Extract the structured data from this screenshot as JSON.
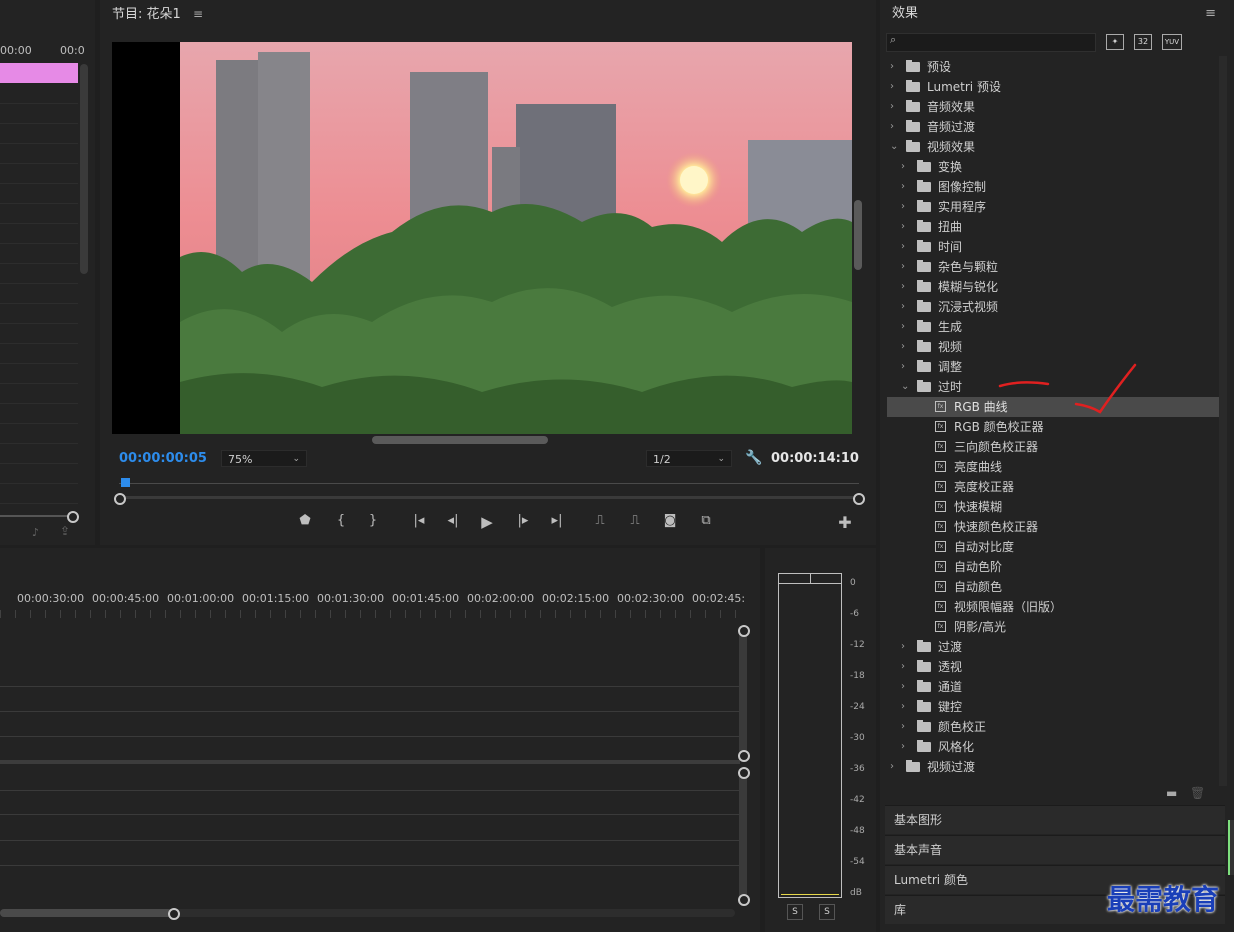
{
  "source_panel": {
    "ruler_left": "00:00",
    "ruler_right": "00:0"
  },
  "program": {
    "title": "节目: 花朵1",
    "current_tc": "00:00:00:05",
    "zoom": "75%",
    "resolution": "1/2",
    "duration_tc": "00:00:14:10",
    "playhead_fraction": 0.006
  },
  "timeline": {
    "ruler_labels": [
      "00:00:30:00",
      "00:00:45:00",
      "00:01:00:00",
      "00:01:15:00",
      "00:01:30:00",
      "00:01:45:00",
      "00:02:00:00",
      "00:02:15:00",
      "00:02:30:00",
      "00:02:45:"
    ]
  },
  "meter": {
    "scale": [
      "0",
      "-6",
      "-12",
      "-18",
      "-24",
      "-30",
      "-36",
      "-42",
      "-48",
      "-54",
      "dB"
    ],
    "solo_left": "S",
    "solo_right": "S"
  },
  "effects": {
    "title": "效果",
    "search_placeholder": "",
    "badge1": "32",
    "badge2": "YUV",
    "tree": [
      {
        "label": "预设",
        "level": 0,
        "kind": "preset",
        "expanded": false
      },
      {
        "label": "Lumetri 预设",
        "level": 0,
        "kind": "preset",
        "expanded": false
      },
      {
        "label": "音频效果",
        "level": 0,
        "kind": "folder",
        "expanded": false
      },
      {
        "label": "音频过渡",
        "level": 0,
        "kind": "folder",
        "expanded": false
      },
      {
        "label": "视频效果",
        "level": 0,
        "kind": "folder",
        "expanded": true
      },
      {
        "label": "变换",
        "level": 1,
        "kind": "folder",
        "expanded": false
      },
      {
        "label": "图像控制",
        "level": 1,
        "kind": "folder",
        "expanded": false
      },
      {
        "label": "实用程序",
        "level": 1,
        "kind": "folder",
        "expanded": false
      },
      {
        "label": "扭曲",
        "level": 1,
        "kind": "folder",
        "expanded": false
      },
      {
        "label": "时间",
        "level": 1,
        "kind": "folder",
        "expanded": false
      },
      {
        "label": "杂色与颗粒",
        "level": 1,
        "kind": "folder",
        "expanded": false
      },
      {
        "label": "模糊与锐化",
        "level": 1,
        "kind": "folder",
        "expanded": false
      },
      {
        "label": "沉浸式视频",
        "level": 1,
        "kind": "folder",
        "expanded": false
      },
      {
        "label": "生成",
        "level": 1,
        "kind": "folder",
        "expanded": false
      },
      {
        "label": "视频",
        "level": 1,
        "kind": "folder",
        "expanded": false
      },
      {
        "label": "调整",
        "level": 1,
        "kind": "folder",
        "expanded": false
      },
      {
        "label": "过时",
        "level": 1,
        "kind": "folder",
        "expanded": true
      },
      {
        "label": "RGB 曲线",
        "level": 2,
        "kind": "fx",
        "selected": true
      },
      {
        "label": "RGB 颜色校正器",
        "level": 2,
        "kind": "fx"
      },
      {
        "label": "三向颜色校正器",
        "level": 2,
        "kind": "fx"
      },
      {
        "label": "亮度曲线",
        "level": 2,
        "kind": "fx"
      },
      {
        "label": "亮度校正器",
        "level": 2,
        "kind": "fx"
      },
      {
        "label": "快速模糊",
        "level": 2,
        "kind": "fx"
      },
      {
        "label": "快速颜色校正器",
        "level": 2,
        "kind": "fx"
      },
      {
        "label": "自动对比度",
        "level": 2,
        "kind": "fx"
      },
      {
        "label": "自动色阶",
        "level": 2,
        "kind": "fx"
      },
      {
        "label": "自动颜色",
        "level": 2,
        "kind": "fx"
      },
      {
        "label": "视频限幅器（旧版）",
        "level": 2,
        "kind": "fx"
      },
      {
        "label": "阴影/高光",
        "level": 2,
        "kind": "fx"
      },
      {
        "label": "过渡",
        "level": 1,
        "kind": "folder",
        "expanded": false
      },
      {
        "label": "透视",
        "level": 1,
        "kind": "folder",
        "expanded": false
      },
      {
        "label": "通道",
        "level": 1,
        "kind": "folder",
        "expanded": false
      },
      {
        "label": "键控",
        "level": 1,
        "kind": "folder",
        "expanded": false
      },
      {
        "label": "颜色校正",
        "level": 1,
        "kind": "folder",
        "expanded": false
      },
      {
        "label": "风格化",
        "level": 1,
        "kind": "folder",
        "expanded": false
      },
      {
        "label": "视频过渡",
        "level": 0,
        "kind": "folder",
        "expanded": false
      }
    ],
    "sections": [
      "基本图形",
      "基本声音",
      "Lumetri 颜色",
      "库"
    ]
  },
  "watermark": "最需教育",
  "colors": {
    "accent": "#2d8ceb",
    "clip": "#e68ae6",
    "annotation": "#e02020",
    "watermark": "#1a3fb8"
  }
}
